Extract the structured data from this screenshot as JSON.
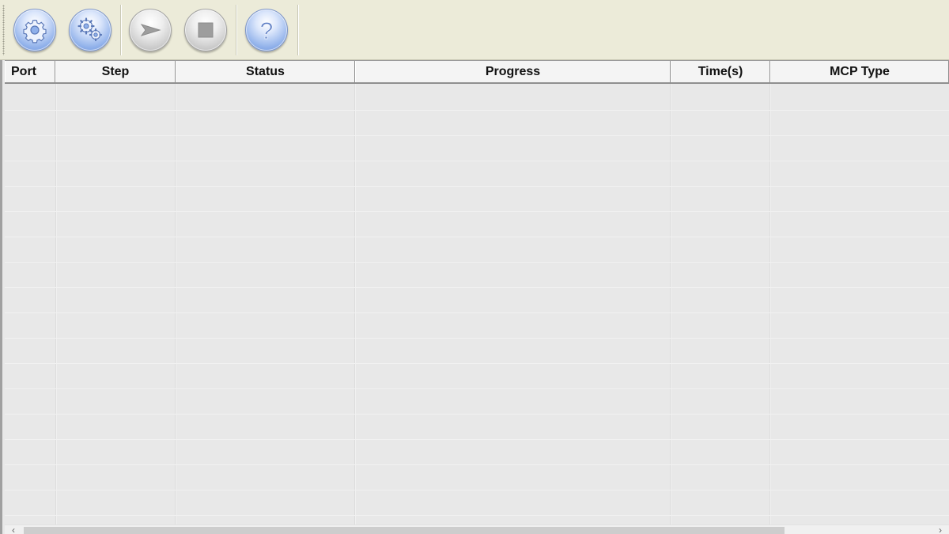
{
  "toolbar": {
    "buttons": [
      {
        "name": "settings-gear-icon",
        "tooltip": ""
      },
      {
        "name": "advanced-settings-gears-icon",
        "tooltip": ""
      },
      {
        "name": "start-play-icon",
        "tooltip": ""
      },
      {
        "name": "stop-icon",
        "tooltip": ""
      },
      {
        "name": "help-question-icon",
        "tooltip": ""
      }
    ],
    "help_glyph": "?"
  },
  "grid": {
    "columns": [
      {
        "label": "Port"
      },
      {
        "label": "Step"
      },
      {
        "label": "Status"
      },
      {
        "label": "Progress"
      },
      {
        "label": "Time(s)"
      },
      {
        "label": "MCP Type"
      }
    ],
    "rows": []
  },
  "scrollbar": {
    "left_arrow": "‹",
    "right_arrow": "›"
  },
  "colors": {
    "toolbar_bg": "#ecebd9",
    "grid_bg": "#e8e8e8",
    "button_blue": "#8fb0ea",
    "button_gray": "#c9c9c9"
  }
}
